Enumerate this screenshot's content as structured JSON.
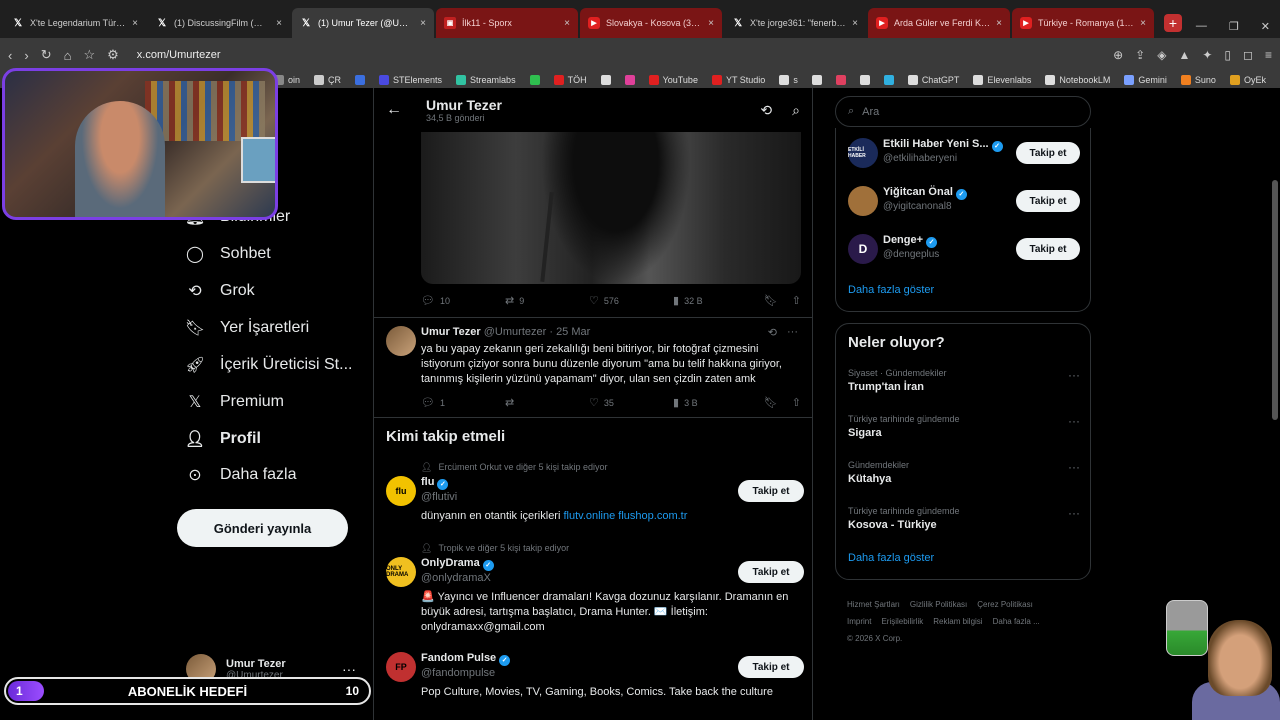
{
  "tabs": [
    {
      "icon": "x-icon",
      "title": "X'te Legendarium Türkiye: \"Rin"
    },
    {
      "icon": "x-icon",
      "title": "(1) DiscussingFilm (@Discussin"
    },
    {
      "icon": "x-icon",
      "title": "(1) Umur Tezer (@Umurtez"
    },
    {
      "icon": "sporx-icon",
      "title": "İlk11 - Sporx"
    },
    {
      "icon": "youtube-icon",
      "title": "Slovakya - Kosova (3-4) M"
    },
    {
      "icon": "x-icon",
      "title": "X'te jorge361: \"fenerbahçe der"
    },
    {
      "icon": "youtube-icon",
      "title": "Arda Güler ve Ferdi Kadıoğlu R"
    },
    {
      "icon": "youtube-icon",
      "title": "Türkiye - Romanya (1-0) Maç Ö"
    }
  ],
  "address_bar": {
    "url": "x.com/Umurtezer"
  },
  "bookmarks": [
    {
      "label": "oin",
      "color": "#888888"
    },
    {
      "label": "ÇR",
      "color": "#cccccc"
    },
    {
      "label": "",
      "color": "#3b6fe0"
    },
    {
      "label": "STElements",
      "color": "#4a4ae0"
    },
    {
      "label": "Streamlabs",
      "color": "#31c3a2"
    },
    {
      "label": "",
      "color": "#2fbf4f"
    },
    {
      "label": "TÖH",
      "color": "#e02020"
    },
    {
      "label": "",
      "color": "#dddddd"
    },
    {
      "label": "",
      "color": "#e0409a"
    },
    {
      "label": "YouTube",
      "color": "#e02020"
    },
    {
      "label": "YT Studio",
      "color": "#e02020"
    },
    {
      "label": "s",
      "color": "#dddddd"
    },
    {
      "label": "",
      "color": "#dddddd"
    },
    {
      "label": "",
      "color": "#e04060"
    },
    {
      "label": "",
      "color": "#dddddd"
    },
    {
      "label": "",
      "color": "#30b0e0"
    },
    {
      "label": "ChatGPT",
      "color": "#dddddd"
    },
    {
      "label": "Elevenlabs",
      "color": "#dddddd"
    },
    {
      "label": "NotebookLM",
      "color": "#dddddd"
    },
    {
      "label": "Gemini",
      "color": "#7aa0ff"
    },
    {
      "label": "Suno",
      "color": "#f08020"
    },
    {
      "label": "OyEk",
      "color": "#e0a020"
    }
  ],
  "leftnav": {
    "items": [
      {
        "label": "Bildirimler",
        "icon": "bell-icon"
      },
      {
        "label": "Sohbet",
        "icon": "chat-bubble-icon"
      },
      {
        "label": "Grok",
        "icon": "grok-icon"
      },
      {
        "label": "Yer İşaretleri",
        "icon": "bookmark-icon"
      },
      {
        "label": "İçerik Üreticisi St...",
        "icon": "rocket-icon"
      },
      {
        "label": "Premium",
        "icon": "x-logo-icon"
      },
      {
        "label": "Profil",
        "icon": "person-icon"
      },
      {
        "label": "Daha fazla",
        "icon": "more-circle-icon"
      }
    ],
    "post_button": "Gönderi yayınla",
    "account": {
      "name": "Umur Tezer",
      "handle": "@Umurtezer"
    }
  },
  "header": {
    "name": "Umur Tezer",
    "post_count": "34,5 B gönderi"
  },
  "tweet1": {
    "replies": "10",
    "retweets": "9",
    "likes": "576",
    "views": "32 B"
  },
  "tweet2": {
    "name": "Umur Tezer",
    "handle": "@Umurtezer",
    "date": "· 25 Mar",
    "text": "ya bu yapay zekanın geri zekalılığı beni bitiriyor, bir fotoğraf çizmesini istiyorum çiziyor sonra bunu düzenle diyorum \"ama bu telif hakkına giriyor, tanınmış kişilerin yüzünü yapamam\" diyor, ulan sen çizdin zaten amk",
    "replies": "1",
    "retweets": "",
    "likes": "35",
    "views": "3 B"
  },
  "who_to_follow": {
    "title": "Kimi takip etmeli",
    "follow_label": "Takip et",
    "items": [
      {
        "context": "Ercüment Orkut ve diğer 5 kişi takip ediyor",
        "name": "flu",
        "handle": "@flutivi",
        "bio": "dünyanın en otantik içerikleri ",
        "links": "flutv.online flushop.com.tr",
        "avatar_text": "flu",
        "avatar_color": "#f2c200"
      },
      {
        "context": "Tropik ve diğer 5 kişi takip ediyor",
        "name": "OnlyDrama",
        "handle": "@onlydramaX",
        "bio": "🚨 Yayıncı ve Influencer dramaları! Kavga dozunuz karşılanır. Dramanın en büyük adresi, tartışma başlatıcı, Drama Hunter. ✉️ İletişim: onlydramaxx@gmail.com",
        "links": "",
        "avatar_text": "ONLY DRAMA",
        "avatar_color": "#f0c020"
      },
      {
        "context": "",
        "name": "Fandom Pulse",
        "handle": "@fandompulse",
        "bio": "Pop Culture, Movies, TV, Gaming, Books, Comics. Take back the culture",
        "links": "",
        "avatar_text": "FP",
        "avatar_color": "#c03030"
      }
    ]
  },
  "search": {
    "placeholder": "Ara"
  },
  "right_follow": {
    "items": [
      {
        "name": "Etkili Haber Yeni S...",
        "handle": "@etkilihaberyeni",
        "avatar_text": "ETKİLİ HABER",
        "avatar_color": "#1a2a5a"
      },
      {
        "name": "Yiğitcan Önal",
        "handle": "@yigitcanonal8",
        "avatar_text": "",
        "avatar_color": "#a0703a"
      },
      {
        "name": "Denge+",
        "handle": "@dengeplus",
        "avatar_text": "D",
        "avatar_color": "#2a1a4a"
      }
    ],
    "follow_label": "Takip et",
    "show_more": "Daha fazla göster"
  },
  "trends": {
    "title": "Neler oluyor?",
    "items": [
      {
        "category": "Siyaset · Gündemdekiler",
        "name": "Trump'tan İran"
      },
      {
        "category": "Türkiye tarihinde gündemde",
        "name": "Sigara"
      },
      {
        "category": "Gündemdekiler",
        "name": "Kütahya"
      },
      {
        "category": "Türkiye tarihinde gündemde",
        "name": "Kosova - Türkiye"
      }
    ],
    "show_more": "Daha fazla göster"
  },
  "footer": {
    "links": [
      "Hizmet Şartları",
      "Gizlilik Politikası",
      "Çerez Politikası",
      "Imprint",
      "Erişilebilirlik",
      "Reklam bilgisi",
      "Daha fazla ..."
    ],
    "copyright": "© 2026 X Corp."
  },
  "stream_overlay": {
    "goal_current": "1",
    "goal_label": "ABONELİK HEDEFİ",
    "goal_target": "10",
    "goal_progress": 0.1
  }
}
